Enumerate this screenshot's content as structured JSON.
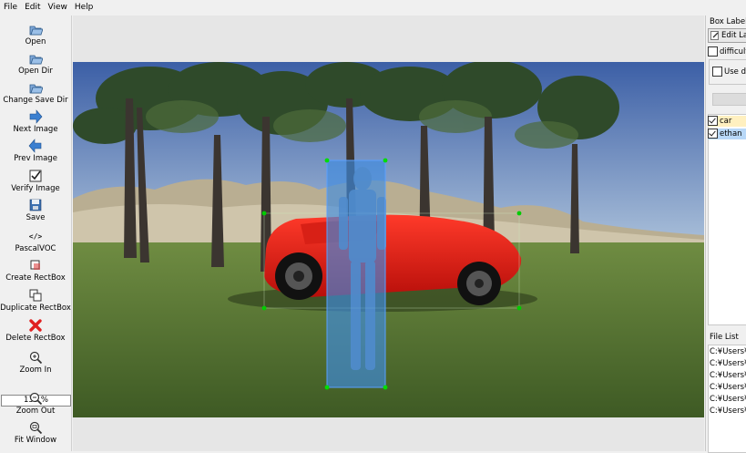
{
  "menu": [
    "File",
    "Edit",
    "View",
    "Help"
  ],
  "tools": [
    {
      "label": "Open",
      "icon": "open-folder-icon"
    },
    {
      "label": "Open Dir",
      "icon": "open-dir-icon"
    },
    {
      "label": "Change Save Dir",
      "icon": "change-save-dir-icon"
    },
    {
      "label": "Next Image",
      "icon": "next-arrow-icon"
    },
    {
      "label": "Prev Image",
      "icon": "prev-arrow-icon"
    },
    {
      "label": "Verify Image",
      "icon": "verify-check-icon"
    },
    {
      "label": "Save",
      "icon": "save-disk-icon"
    },
    {
      "label": "PascalVOC",
      "icon": "code-tag-icon"
    },
    {
      "label": "Create RectBox",
      "icon": "create-rectbox-icon"
    },
    {
      "label": "Duplicate RectBox",
      "icon": "duplicate-rectbox-icon"
    },
    {
      "label": "Delete RectBox",
      "icon": "delete-x-icon"
    },
    {
      "label": "Zoom In",
      "icon": "zoom-in-icon"
    },
    {
      "label": "Zoom Out",
      "icon": "zoom-out-icon"
    },
    {
      "label": "Fit Window",
      "icon": "fit-window-icon"
    }
  ],
  "zoom": {
    "value": "135 %"
  },
  "right_panel": {
    "box_labels_title": "Box Labels",
    "edit_label_button": "Edit La",
    "difficult_label": "difficult",
    "use_default_label": "Use d",
    "labels": [
      {
        "text": "car",
        "checked": true,
        "color": "#fff0c0"
      },
      {
        "text": "ethan",
        "checked": true,
        "color": "#b8d8f8"
      }
    ],
    "file_list_title": "File List",
    "files": [
      "C:¥Users¥s",
      "C:¥Users¥s",
      "C:¥Users¥s",
      "C:¥Users¥s",
      "C:¥Users¥s",
      "C:¥Users¥s"
    ]
  },
  "colors": {
    "ethan_box": "#3f8ce0",
    "car_handle": "#00cc00",
    "box_outline": "#00dd00"
  }
}
